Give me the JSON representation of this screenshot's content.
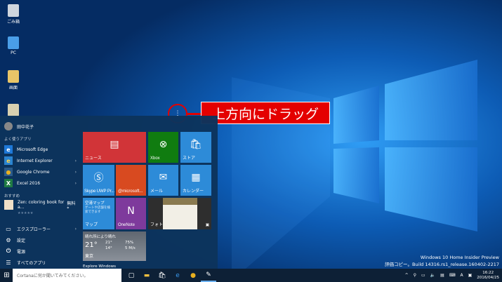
{
  "desktop": {
    "icons": [
      {
        "label": "ごみ箱"
      },
      {
        "label": "PC"
      },
      {
        "label": "画面"
      },
      {
        "label": ""
      }
    ]
  },
  "annotation": {
    "text": "上方向にドラッグ",
    "handle": "⋮"
  },
  "start": {
    "user": "田中花子",
    "most_used_header": "よく使うアプリ",
    "apps": [
      {
        "label": "Microsoft Edge",
        "icon": "e"
      },
      {
        "label": "Internet Explorer",
        "icon": "e"
      },
      {
        "label": "Google Chrome",
        "icon": "●"
      },
      {
        "label": "Excel 2016",
        "icon": "X"
      }
    ],
    "suggested_header": "おすすめ",
    "suggested": {
      "label": "Zen: coloring book for a...",
      "badge": "無料*",
      "rating": "★★★★★"
    },
    "bottom": [
      {
        "label": "エクスプローラー"
      },
      {
        "label": "設定"
      },
      {
        "label": "電源"
      },
      {
        "label": "すべてのアプリ"
      }
    ],
    "tiles": {
      "news": "ニュース",
      "xbox": "Xbox",
      "store": "ストア",
      "skype": "Skype UWP Pr...",
      "microsoft": "@microsoft...",
      "mail": "メール",
      "calendar": "カレンダー",
      "maps": {
        "label": "マップ",
        "title": "空港マップ",
        "desc": "ゲートや店舗を検索できます"
      },
      "onenote": "OneNote",
      "photos": "フォト",
      "weather": {
        "condition": "晴れ所により晴れ",
        "temp": "21°",
        "high": "21°",
        "low": "14°",
        "humidity": "75%",
        "wind": "5 M/s",
        "city": "東京"
      },
      "group": "Explore Windows"
    }
  },
  "taskbar": {
    "search_placeholder": "Cortanaに何か聞いてみてください。",
    "time": "16:22",
    "date": "2016/04/25",
    "ime": "A"
  },
  "watermark": {
    "line1": "Windows 10 Home Insider Preview",
    "line2": "評価コピー。Build 14316.rs1_release.160402-2217"
  }
}
